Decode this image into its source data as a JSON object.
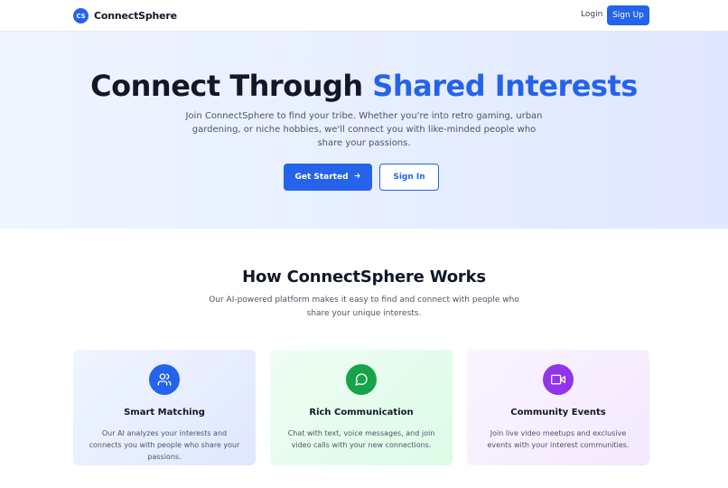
{
  "header": {
    "logo_text": "CS",
    "brand": "ConnectSphere",
    "login_label": "Login",
    "signup_label": "Sign Up"
  },
  "hero": {
    "title_part1": "Connect Through ",
    "title_accent": "Shared Interests",
    "subtitle": "Join ConnectSphere to find your tribe. Whether you're into retro gaming, urban gardening, or niche hobbies, we'll connect you with like-minded people who share your passions.",
    "primary_button": "Get Started",
    "secondary_button": "Sign In"
  },
  "how": {
    "title": "How ConnectSphere Works",
    "subtitle": "Our AI-powered platform makes it easy to find and connect with people who share your unique interests."
  },
  "features": [
    {
      "title": "Smart Matching",
      "description": "Our AI analyzes your interests and connects you with people who share your passions.",
      "icon": "users-icon",
      "color": "#2563eb"
    },
    {
      "title": "Rich Communication",
      "description": "Chat with text, voice messages, and join video calls with your new connections.",
      "icon": "message-circle-icon",
      "color": "#16a34a"
    },
    {
      "title": "Community Events",
      "description": "Join live video meetups and exclusive events with your interest communities.",
      "icon": "video-icon",
      "color": "#9333ea"
    }
  ],
  "colors": {
    "primary": "#2563eb",
    "text_dark": "#111827",
    "text_muted": "#4b5563"
  }
}
